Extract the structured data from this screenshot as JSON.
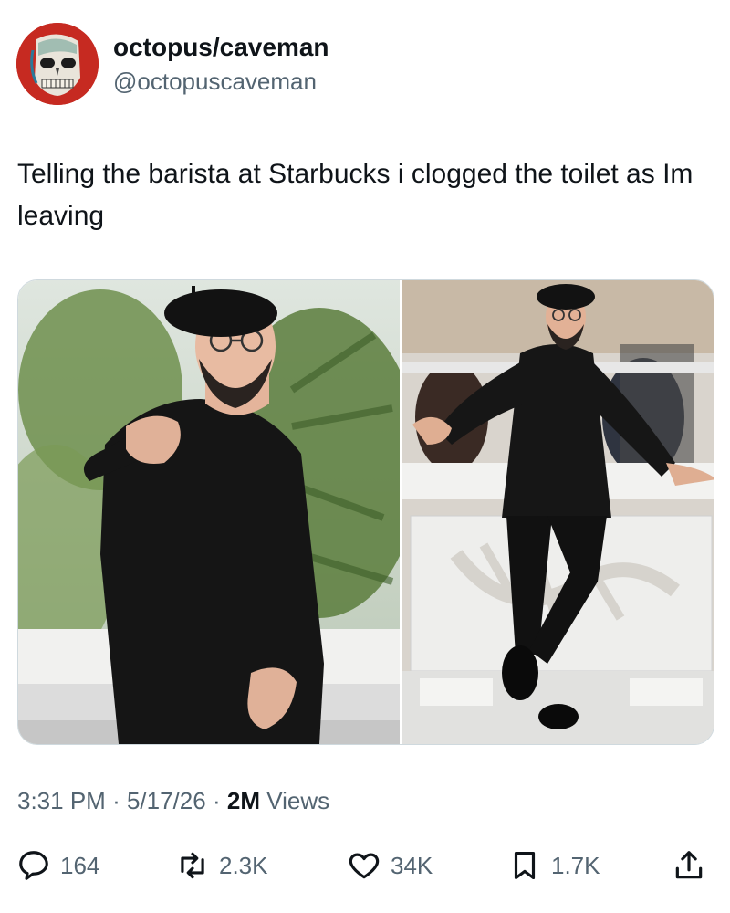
{
  "author": {
    "display_name": "octopus/caveman",
    "handle": "@octopuscaveman",
    "avatar_icon": "skull-face-avatar",
    "avatar_bg": "#c62a21"
  },
  "tweet": {
    "text": "Telling the barista at Starbucks i clogged the toilet as Im leaving"
  },
  "media": {
    "photos": [
      {
        "label": "man in black beret and black shirt pointing at camera"
      },
      {
        "label": "man in black beret posing in front of Cannes palm backdrop"
      }
    ]
  },
  "meta": {
    "time": "3:31 PM",
    "separator1": "·",
    "date": "5/17/26",
    "separator2": "·",
    "views_count": "2M",
    "views_label": "Views"
  },
  "actions": {
    "replies": {
      "icon": "reply-bubble-icon",
      "count": "164"
    },
    "reposts": {
      "icon": "repost-icon",
      "count": "2.3K"
    },
    "likes": {
      "icon": "heart-icon",
      "count": "34K"
    },
    "bookmarks": {
      "icon": "bookmark-icon",
      "count": "1.7K"
    },
    "share": {
      "icon": "share-icon"
    }
  },
  "colors": {
    "text_primary": "#0f1419",
    "text_secondary": "#536471",
    "border": "#cfd9de"
  }
}
